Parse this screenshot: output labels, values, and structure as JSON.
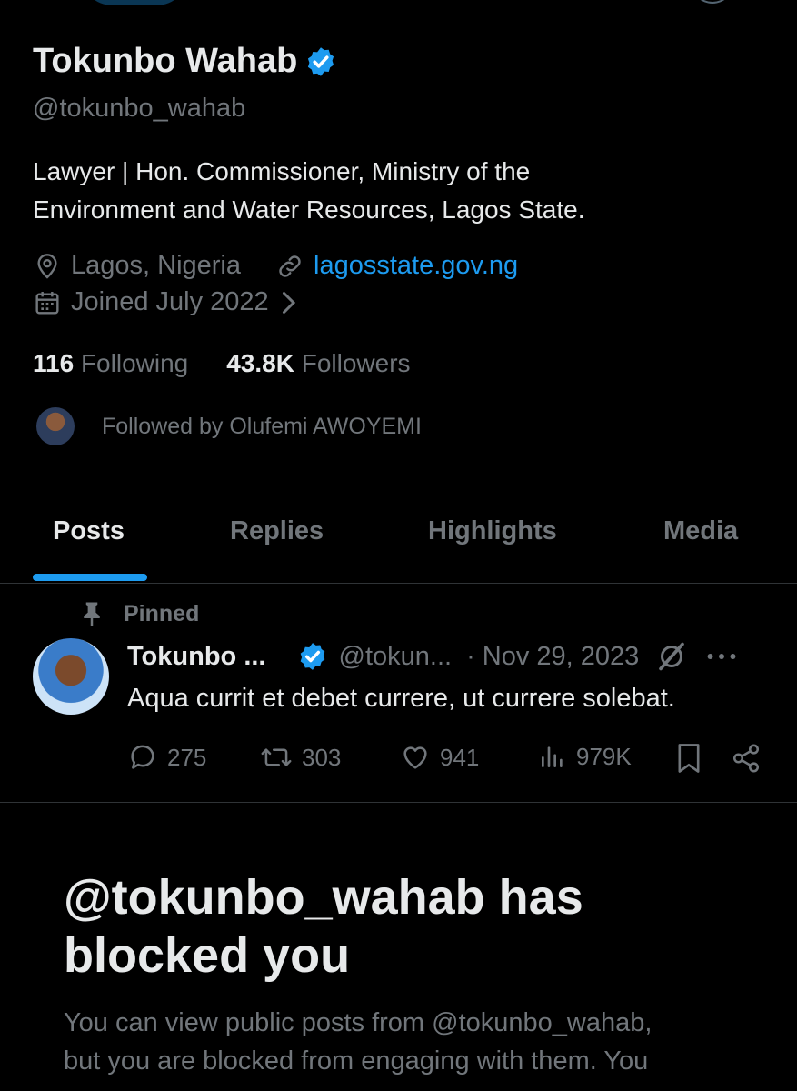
{
  "profile": {
    "name": "Tokunbo Wahab",
    "handle": "@tokunbo_wahab",
    "bio_line1": "Lawyer | Hon. Commissioner, Ministry of the",
    "bio_line2": "Environment and Water Resources, Lagos State.",
    "location": "Lagos, Nigeria",
    "website": "lagosstate.gov.ng",
    "joined": "Joined July 2022",
    "following_count": "116",
    "following_label": "Following",
    "followers_count": "43.8K",
    "followers_label": "Followers",
    "followed_by": "Followed by Olufemi AWOYEMI"
  },
  "tabs": [
    {
      "label": "Posts",
      "active": true
    },
    {
      "label": "Replies"
    },
    {
      "label": "Highlights"
    },
    {
      "label": "Media"
    }
  ],
  "pinned_post": {
    "pinned_label": "Pinned",
    "name": "Tokunbo ...",
    "handle": "@tokun...",
    "date": "· Nov 29, 2023",
    "text": "Aqua currit et debet currere, ut currere solebat.",
    "replies": "275",
    "reposts": "303",
    "likes": "941",
    "views": "979K"
  },
  "blocked": {
    "title_line1": "@tokunbo_wahab has",
    "title_line2": "blocked you",
    "body_line1": "You can view public posts from @tokunbo_wahab,",
    "body_line2": "but you are blocked from engaging with them. You"
  },
  "colors": {
    "background": "#000000",
    "primary_text": "#e7e9ea",
    "muted_text": "#71767b",
    "accent": "#1d9bf0"
  }
}
